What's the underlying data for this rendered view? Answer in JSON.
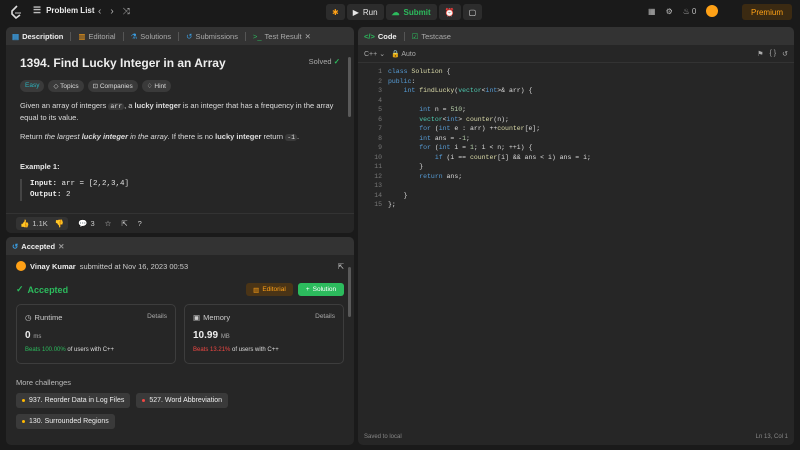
{
  "topbar": {
    "problem_list": "Problem List",
    "run": "Run",
    "submit": "Submit",
    "streak": "0",
    "premium": "Premium"
  },
  "description": {
    "tabs": [
      "Description",
      "Editorial",
      "Solutions",
      "Submissions",
      "Test Result"
    ],
    "title": "1394. Find Lucky Integer in an Array",
    "status": "Solved",
    "chips": [
      "Easy",
      "Topics",
      "Companies",
      "Hint"
    ],
    "p1_a": "Given an array of integers ",
    "p1_code": "arr",
    "p1_b": ", a ",
    "p1_bold": "lucky integer",
    "p1_c": " is an integer that has a frequency in the array equal to its value.",
    "p2_a": "Return ",
    "p2_em1": "the largest ",
    "p2_bold1": "lucky integer",
    "p2_em2": " in the array",
    "p2_b": ". If there is no ",
    "p2_bold2": "lucky integer",
    "p2_c": " return ",
    "p2_code": "-1",
    "p2_d": ".",
    "example_heading": "Example 1:",
    "ex_input_label": "Input:",
    "ex_input": " arr = [2,2,3,4]",
    "ex_output_label": "Output:",
    "ex_output": " 2",
    "likes": "1.1K",
    "comments": "3"
  },
  "submission": {
    "tab": "Accepted",
    "user": "Vinay Kumar",
    "submitted": "submitted at Nov 16, 2023 00:53",
    "status": "Accepted",
    "editorial_btn": "Editorial",
    "solution_btn": "Solution",
    "runtime": {
      "label": "Runtime",
      "details": "Details",
      "value": "0",
      "unit": "ms",
      "beats": "Beats 100.00%",
      "beats_rest": " of users with C++"
    },
    "memory": {
      "label": "Memory",
      "details": "Details",
      "value": "10.99",
      "unit": "MB",
      "beats": "Beats 13.21%",
      "beats_rest": " of users with C++"
    },
    "more_title": "More challenges",
    "challenges": [
      {
        "label": "937. Reorder Data in Log Files",
        "color": "#ffb800"
      },
      {
        "label": "527. Word Abbreviation",
        "color": "#ef4743"
      },
      {
        "label": "130. Surrounded Regions",
        "color": "#ffb800"
      }
    ]
  },
  "code": {
    "tab_code": "Code",
    "tab_testcase": "Testcase",
    "language": "C++",
    "auto": "Auto",
    "lines": [
      "class Solution {",
      "public:",
      "    int findLucky(vector<int>& arr) {",
      "",
      "        int n = 510;",
      "        vector<int> counter(n);",
      "        for (int e : arr) ++counter[e];",
      "        int ans = -1;",
      "        for (int i = 1; i < n; ++i) {",
      "            if (i == counter[i] && ans < i) ans = i;",
      "        }",
      "        return ans;",
      "",
      "    }",
      "};"
    ],
    "saved": "Saved to local",
    "cursor": "Ln 13, Col 1"
  }
}
